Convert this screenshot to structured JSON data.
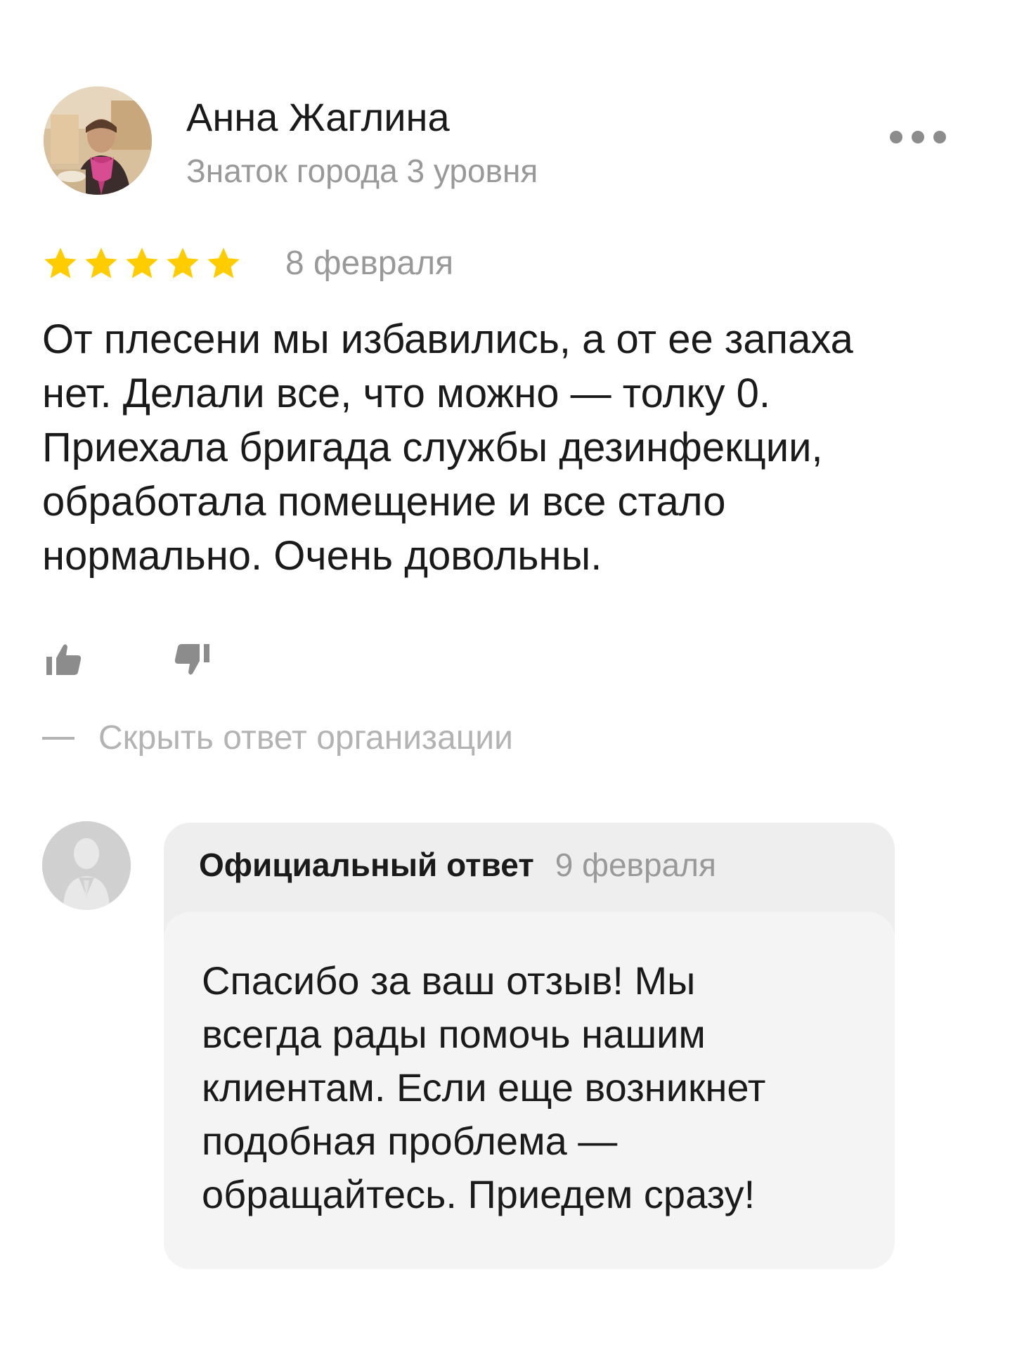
{
  "review": {
    "author": {
      "name": "Анна Жаглина",
      "level": "Знаток города 3 уровня",
      "avatar_icon": "user-photo-avatar"
    },
    "more_icon": "more-dots-icon",
    "rating": {
      "stars": 5,
      "max": 5,
      "color": "#fc0"
    },
    "date": "8 февраля",
    "text": "От плесени мы избавились, а от ее запаха\nнет. Делали все, что можно — толку 0.\nПриехала бригада службы дезинфекции,\nобработала помещение и все стало\nнормально. Очень довольны.",
    "reactions": {
      "like_icon": "thumbs-up-icon",
      "dislike_icon": "thumbs-down-icon"
    },
    "toggle_answer": {
      "label": "Скрыть ответ организации"
    }
  },
  "answer": {
    "avatar_icon": "organization-avatar-placeholder",
    "title": "Официальный ответ",
    "date": "9 февраля",
    "text": "Спасибо за ваш отзыв! Мы\nвсегда рады помочь нашим\nклиентам. Если еще возникнет\nподобная проблема —\nобращайтесь. Приедем сразу!"
  }
}
